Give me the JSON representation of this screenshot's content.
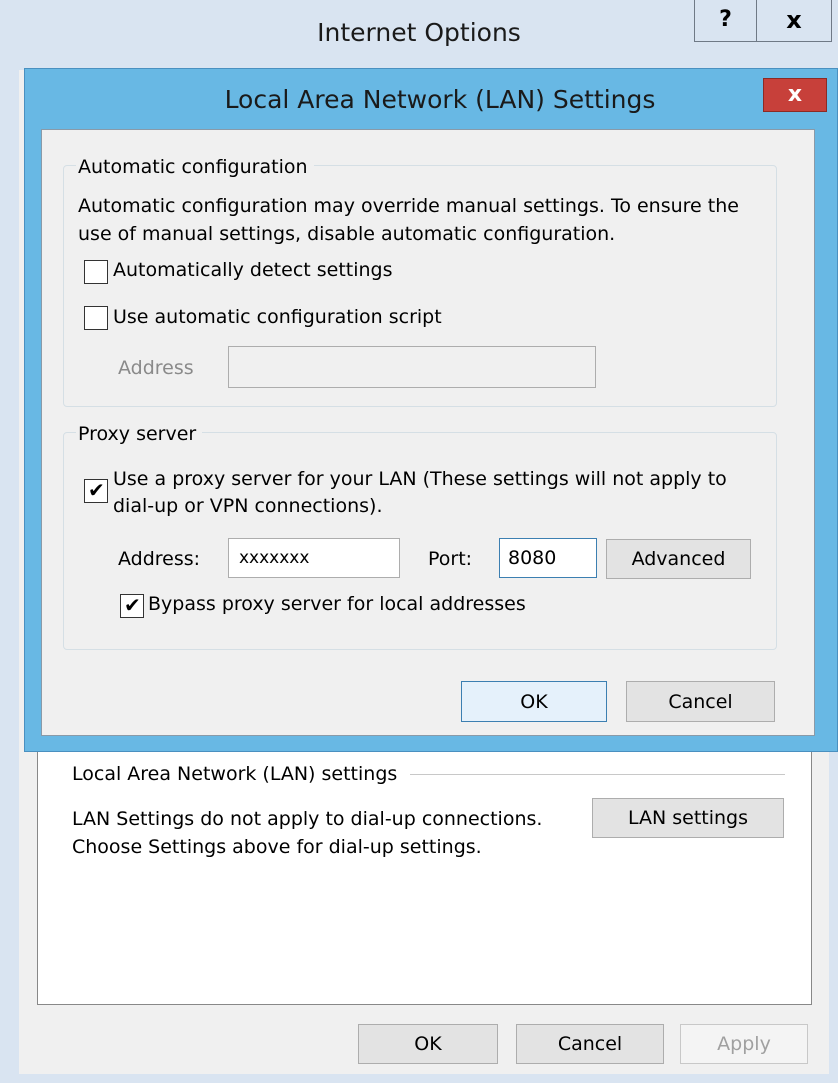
{
  "outer_window": {
    "title": "Internet Options",
    "help_label": "?",
    "close_label": "x",
    "lan_section": {
      "heading": "Local Area Network (LAN) settings",
      "description_line1": "LAN Settings do not apply to dial-up connections.",
      "description_line2": "Choose Settings above for dial-up settings.",
      "lan_settings_button": "LAN settings"
    },
    "buttons": {
      "ok": "OK",
      "cancel": "Cancel",
      "apply": "Apply"
    }
  },
  "lan_dialog": {
    "title": "Local Area Network (LAN) Settings",
    "close_label": "x",
    "automatic_configuration": {
      "legend": "Automatic configuration",
      "description_line1": "Automatic configuration may override manual settings.  To ensure the",
      "description_line2": "use of manual settings, disable automatic configuration.",
      "auto_detect_label": "Automatically detect settings",
      "auto_detect_checked": false,
      "script_label": "Use automatic configuration script",
      "script_checked": false,
      "address_label": "Address",
      "address_value": ""
    },
    "proxy_server": {
      "legend": "Proxy server",
      "use_proxy_label_line1": "Use a proxy server for your LAN (These settings will not apply to",
      "use_proxy_label_line2": "dial-up or VPN connections).",
      "use_proxy_checked": true,
      "address_label": "Address:",
      "address_value": "xxxxxxx",
      "port_label": "Port:",
      "port_value": "8080",
      "advanced_button": "Advanced",
      "bypass_label": "Bypass proxy server for local addresses",
      "bypass_checked": true
    },
    "buttons": {
      "ok": "OK",
      "cancel": "Cancel"
    }
  },
  "checkmark_glyph": "✔",
  "colors": {
    "dialog_frame": "#68b8e4",
    "close_button": "#c7403a",
    "outer_frame": "#d9e4f1"
  }
}
